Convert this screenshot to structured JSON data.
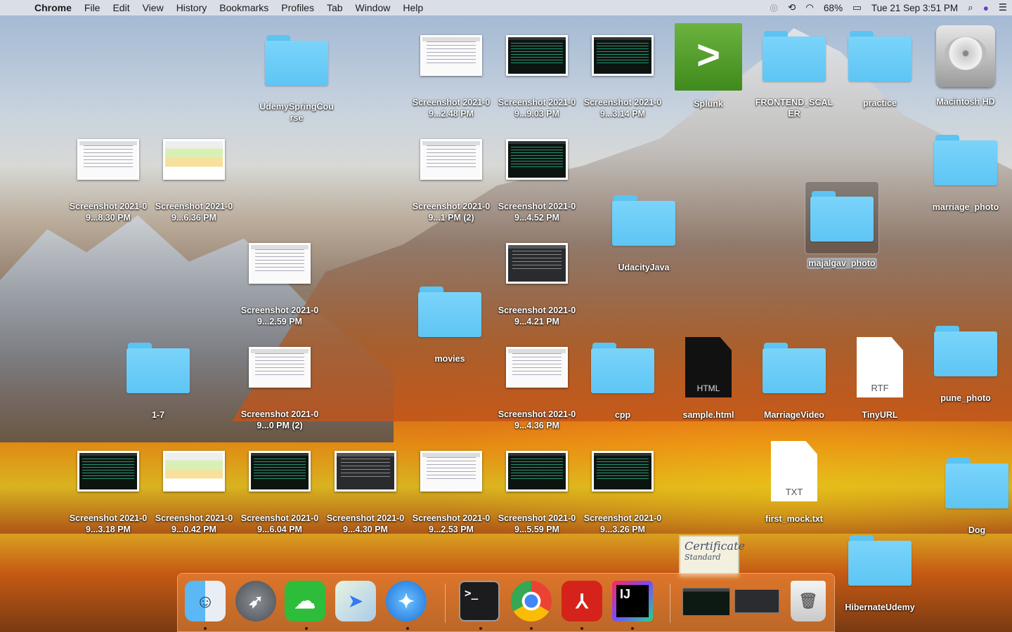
{
  "menubar": {
    "app_name": "Chrome",
    "items": [
      "File",
      "Edit",
      "View",
      "History",
      "Bookmarks",
      "Profiles",
      "Tab",
      "Window",
      "Help"
    ],
    "battery": "68%",
    "datetime": "Tue 21 Sep  3:51 PM"
  },
  "desktop": {
    "udemy": "UdemySpringCourse",
    "ss_248": "Screenshot 2021-09...2.48 PM",
    "ss_903": "Screenshot 2021-09...9.03 PM",
    "ss_314": "Screenshot 2021-09...3.14 PM",
    "splunk": "Splunk",
    "frontend": "FRONTEND_SCALER",
    "practice": "practice",
    "macintosh": "Macintosh HD",
    "ss_830": "Screenshot 2021-09...8.30 PM",
    "ss_636": "Screenshot 2021-09...6.36 PM",
    "ss_1pm2": "Screenshot 2021-09...1 PM (2)",
    "ss_452": "Screenshot 2021-09...4.52 PM",
    "marriage_photo": "marriage_photo",
    "udacity": "UdacityJava",
    "majalgav": "majalgav_photo",
    "ss_259": "Screenshot 2021-09...2.59 PM",
    "ss_421": "Screenshot 2021-09...4.21 PM",
    "movies": "movies",
    "f17": "1-7",
    "ss_0pm2": "Screenshot 2021-09...0 PM (2)",
    "ss_436": "Screenshot 2021-09...4.36 PM",
    "cpp": "cpp",
    "sample": "sample.html",
    "marriagevideo": "MarriageVideo",
    "tinyurl": "TinyURL",
    "pune": "pune_photo",
    "ss_318": "Screenshot 2021-09...3.18 PM",
    "ss_042": "Screenshot 2021-09...0.42 PM",
    "ss_604": "Screenshot 2021-09...6.04 PM",
    "ss_430": "Screenshot 2021-09...4.30 PM",
    "ss_253": "Screenshot 2021-09...2.53 PM",
    "ss_559": "Screenshot 2021-09...5.59 PM",
    "ss_326": "Screenshot 2021-09...3.26 PM",
    "firstmock": "first_mock.txt",
    "dog": "Dog",
    "hibernate": "HibernateUdemy",
    "rtf_tag": "RTF",
    "txt_tag": "TXT",
    "html_tag": "HTML",
    "splunk_glyph": ">",
    "cert_text": "Certificate",
    "cert_sub": "Standard"
  },
  "dock": {
    "terminal_glyph": ">_",
    "intellij_glyph": "IJ"
  }
}
